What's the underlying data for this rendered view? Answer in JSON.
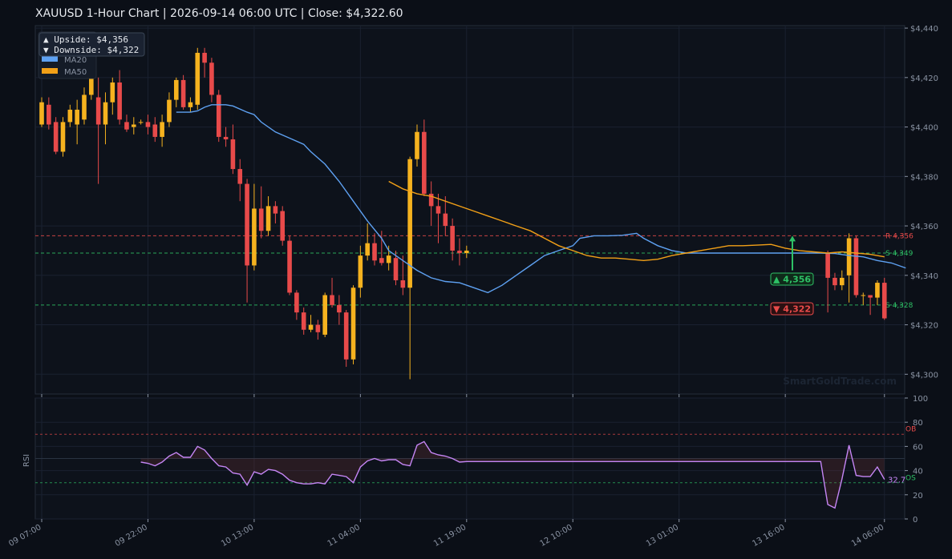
{
  "title": "XAUUSD  1-Hour Chart  |  2026-09-14 06:00 UTC  |  Close: $4,322.60",
  "watermark": "SmartGoldTrade.com",
  "info_box": {
    "upside": "▲ Upside:   $4,356",
    "downside": "▼ Downside: $4,322"
  },
  "badges": {
    "up": "▲ 4,356",
    "down": "▼ 4,322"
  },
  "colors": {
    "bull": "#f5b21f",
    "bear": "#e84a4a",
    "ma20": "#5ea1f2",
    "ma50": "#f2a017",
    "rsi": "#c586f5",
    "resistance": "#e84a4a",
    "support": "#2ec166",
    "background": "#0b0f17"
  },
  "chart_data": [
    {
      "type": "candlestick",
      "name": "price",
      "ylim": [
        4292,
        4441
      ],
      "yticks": [
        "$4,300",
        "$4,320",
        "$4,340",
        "$4,360",
        "$4,380",
        "$4,400",
        "$4,420",
        "$4,440"
      ],
      "ytick_values": [
        4300,
        4320,
        4340,
        4360,
        4380,
        4400,
        4420,
        4440
      ],
      "x_labels": [
        "09 07:00",
        "09 22:00",
        "10 13:00",
        "11 04:00",
        "11 19:00",
        "12 10:00",
        "13 01:00",
        "13 16:00",
        "14 06:00"
      ],
      "x_label_index": [
        0,
        15,
        30,
        45,
        60,
        75,
        90,
        105,
        119
      ],
      "n_slots": 120,
      "candles": [
        [
          0,
          4401,
          4410,
          4412,
          4400
        ],
        [
          1,
          4409,
          4401,
          4412,
          4399
        ],
        [
          2,
          4402,
          4390,
          4404,
          4389
        ],
        [
          3,
          4390,
          4402,
          4404,
          4388
        ],
        [
          4,
          4402,
          4407,
          4409,
          4400
        ],
        [
          5,
          4401,
          4407,
          4411,
          4393
        ],
        [
          6,
          4403,
          4413,
          4416,
          4401
        ],
        [
          7,
          4413,
          4420,
          4424,
          4411
        ],
        [
          8,
          4412,
          4401,
          4420,
          4377
        ],
        [
          9,
          4401,
          4410,
          4414,
          4393
        ],
        [
          10,
          4410,
          4418,
          4420,
          4405
        ],
        [
          11,
          4418,
          4403,
          4423,
          4401
        ],
        [
          12,
          4402,
          4399,
          4405,
          4398
        ],
        [
          13,
          4400,
          4401,
          4404,
          4397
        ],
        [
          14,
          4402,
          4402,
          4403,
          4401
        ],
        [
          15,
          4402,
          4400,
          4405,
          4397
        ],
        [
          16,
          4401,
          4396,
          4404,
          4394
        ],
        [
          17,
          4396,
          4402,
          4405,
          4392
        ],
        [
          18,
          4402,
          4411,
          4414,
          4400
        ],
        [
          19,
          4411,
          4419,
          4420,
          4408
        ],
        [
          20,
          4419,
          4408,
          4421,
          4407
        ],
        [
          21,
          4408,
          4410,
          4412,
          4406
        ],
        [
          22,
          4409,
          4430,
          4432,
          4407
        ],
        [
          23,
          4430,
          4426,
          4432,
          4420
        ],
        [
          24,
          4426,
          4413,
          4428,
          4410
        ],
        [
          25,
          4413,
          4396,
          4415,
          4394
        ],
        [
          26,
          4396,
          4395,
          4400,
          4392
        ],
        [
          27,
          4395,
          4383,
          4401,
          4381
        ],
        [
          28,
          4383,
          4377,
          4387,
          4370
        ],
        [
          29,
          4377,
          4344,
          4379,
          4329
        ],
        [
          30,
          4344,
          4367,
          4377,
          4342
        ],
        [
          31,
          4367,
          4358,
          4376,
          4355
        ],
        [
          32,
          4358,
          4368,
          4372,
          4356
        ],
        [
          33,
          4368,
          4365,
          4370,
          4361
        ],
        [
          34,
          4366,
          4354,
          4368,
          4352
        ],
        [
          35,
          4354,
          4333,
          4356,
          4332
        ],
        [
          36,
          4333,
          4325,
          4334,
          4322
        ],
        [
          37,
          4325,
          4318,
          4327,
          4316
        ],
        [
          38,
          4318,
          4320,
          4324,
          4317
        ],
        [
          39,
          4320,
          4317,
          4322,
          4314
        ],
        [
          40,
          4316,
          4332,
          4333,
          4315
        ],
        [
          41,
          4332,
          4328,
          4339,
          4327
        ],
        [
          42,
          4328,
          4325,
          4332,
          4320
        ],
        [
          43,
          4325,
          4306,
          4326,
          4303
        ],
        [
          44,
          4306,
          4335,
          4336,
          4304
        ],
        [
          45,
          4335,
          4348,
          4352,
          4331
        ],
        [
          46,
          4348,
          4353,
          4361,
          4346
        ],
        [
          47,
          4353,
          4346,
          4357,
          4344
        ],
        [
          48,
          4347,
          4345,
          4358,
          4344
        ],
        [
          49,
          4345,
          4348,
          4352,
          4342
        ],
        [
          50,
          4347,
          4338,
          4350,
          4336
        ],
        [
          51,
          4338,
          4335,
          4348,
          4332
        ],
        [
          52,
          4335,
          4387,
          4388,
          4298
        ],
        [
          53,
          4387,
          4398,
          4401,
          4384
        ],
        [
          54,
          4398,
          4373,
          4403,
          4372
        ],
        [
          55,
          4373,
          4368,
          4378,
          4360
        ],
        [
          56,
          4368,
          4365,
          4373,
          4353
        ],
        [
          57,
          4365,
          4360,
          4372,
          4356
        ],
        [
          58,
          4360,
          4350,
          4363,
          4346
        ],
        [
          59,
          4350,
          4349,
          4355,
          4344
        ],
        [
          60,
          4349,
          4350,
          4352,
          4347
        ],
        [
          111,
          4349,
          4339,
          4350,
          4325
        ],
        [
          112,
          4339,
          4336,
          4341,
          4334
        ],
        [
          113,
          4336,
          4339,
          4342,
          4334
        ],
        [
          114,
          4340,
          4355,
          4357,
          4329
        ],
        [
          115,
          4355,
          4332,
          4356,
          4331
        ],
        [
          116,
          4332,
          4332,
          4333,
          4328
        ],
        [
          117,
          4332,
          4331,
          4332,
          4324
        ],
        [
          118,
          4331,
          4337,
          4338,
          4328
        ],
        [
          119,
          4337,
          4322.6,
          4339,
          4322
        ]
      ],
      "ma20": {
        "name": "MA20",
        "points": [
          [
            19,
            4406
          ],
          [
            21,
            4406
          ],
          [
            22,
            4406.5
          ],
          [
            23,
            4408
          ],
          [
            24,
            4409
          ],
          [
            26,
            4409
          ],
          [
            27,
            4408.5
          ],
          [
            29,
            4406
          ],
          [
            30,
            4405
          ],
          [
            31,
            4402
          ],
          [
            33,
            4398
          ],
          [
            35,
            4395.5
          ],
          [
            37,
            4393
          ],
          [
            38,
            4390
          ],
          [
            40,
            4385
          ],
          [
            42,
            4378
          ],
          [
            44,
            4370
          ],
          [
            46,
            4362
          ],
          [
            48,
            4355
          ],
          [
            49,
            4350
          ],
          [
            51,
            4346
          ],
          [
            53,
            4342
          ],
          [
            55,
            4339
          ],
          [
            57,
            4337.5
          ],
          [
            59,
            4337
          ],
          [
            61,
            4335
          ],
          [
            63,
            4333
          ],
          [
            65,
            4336
          ],
          [
            67,
            4340
          ],
          [
            69,
            4344
          ],
          [
            71,
            4348
          ],
          [
            73,
            4350
          ],
          [
            75,
            4352
          ],
          [
            76,
            4355
          ],
          [
            78,
            4356
          ],
          [
            80,
            4356
          ],
          [
            82,
            4356.2
          ],
          [
            84,
            4357
          ],
          [
            85,
            4355
          ],
          [
            87,
            4352
          ],
          [
            89,
            4350
          ],
          [
            91,
            4349
          ],
          [
            93,
            4349
          ],
          [
            95,
            4349
          ],
          [
            100,
            4349
          ],
          [
            105,
            4349
          ],
          [
            108,
            4349
          ],
          [
            110,
            4349
          ],
          [
            112,
            4348.8
          ],
          [
            114,
            4348
          ],
          [
            116,
            4347.5
          ],
          [
            118,
            4346
          ],
          [
            120,
            4345
          ],
          [
            122,
            4343
          ]
        ]
      },
      "ma50": {
        "name": "MA50",
        "points": [
          [
            49,
            4378
          ],
          [
            51,
            4375
          ],
          [
            53,
            4373
          ],
          [
            55,
            4372
          ],
          [
            57,
            4370
          ],
          [
            59,
            4368
          ],
          [
            61,
            4366
          ],
          [
            63,
            4364
          ],
          [
            65,
            4362
          ],
          [
            67,
            4360
          ],
          [
            69,
            4358
          ],
          [
            71,
            4355
          ],
          [
            73,
            4352
          ],
          [
            75,
            4350
          ],
          [
            77,
            4348
          ],
          [
            79,
            4347
          ],
          [
            81,
            4347
          ],
          [
            83,
            4346.5
          ],
          [
            85,
            4346
          ],
          [
            87,
            4346.5
          ],
          [
            89,
            4348
          ],
          [
            91,
            4349
          ],
          [
            93,
            4350
          ],
          [
            95,
            4351
          ],
          [
            97,
            4352
          ],
          [
            99,
            4352
          ],
          [
            101,
            4352.2
          ],
          [
            103,
            4352.5
          ],
          [
            105,
            4351
          ],
          [
            107,
            4350
          ],
          [
            109,
            4349.5
          ],
          [
            111,
            4349
          ],
          [
            113,
            4349.5
          ],
          [
            115,
            4349
          ],
          [
            117,
            4348.5
          ],
          [
            119,
            4347.5
          ]
        ]
      },
      "levels": [
        {
          "label": "R 4,356",
          "value": 4356,
          "kind": "resistance"
        },
        {
          "label": "S 4,349",
          "value": 4349,
          "kind": "support"
        },
        {
          "label": "S 4,328",
          "value": 4328,
          "kind": "support"
        }
      ]
    },
    {
      "type": "line",
      "name": "rsi",
      "ylabel": "RSI",
      "ylim": [
        0,
        100
      ],
      "yticks": [
        "0",
        "20",
        "40",
        "60",
        "80",
        "100"
      ],
      "ytick_values": [
        0,
        20,
        40,
        60,
        80,
        100
      ],
      "overbought": {
        "label": "OB",
        "value": 70
      },
      "oversold": {
        "label": "OS",
        "value": 30
      },
      "last_label": "32.7",
      "points": [
        [
          14,
          47
        ],
        [
          15,
          46
        ],
        [
          16,
          44
        ],
        [
          17,
          47
        ],
        [
          18,
          52
        ],
        [
          19,
          55
        ],
        [
          20,
          51
        ],
        [
          21,
          51
        ],
        [
          22,
          60
        ],
        [
          23,
          57
        ],
        [
          24,
          50
        ],
        [
          25,
          44
        ],
        [
          26,
          43
        ],
        [
          27,
          38
        ],
        [
          28,
          37
        ],
        [
          29,
          28
        ],
        [
          30,
          39
        ],
        [
          31,
          37
        ],
        [
          32,
          41
        ],
        [
          33,
          40
        ],
        [
          34,
          37
        ],
        [
          35,
          32
        ],
        [
          36,
          30
        ],
        [
          37,
          29
        ],
        [
          38,
          29
        ],
        [
          39,
          30
        ],
        [
          40,
          29
        ],
        [
          41,
          37
        ],
        [
          42,
          36
        ],
        [
          43,
          35
        ],
        [
          44,
          30
        ],
        [
          45,
          43
        ],
        [
          46,
          48
        ],
        [
          47,
          50
        ],
        [
          48,
          48
        ],
        [
          49,
          49
        ],
        [
          50,
          49
        ],
        [
          51,
          45
        ],
        [
          52,
          44
        ],
        [
          53,
          61
        ],
        [
          54,
          64
        ],
        [
          55,
          55
        ],
        [
          56,
          53
        ],
        [
          57,
          52
        ],
        [
          58,
          50
        ],
        [
          59,
          47
        ],
        [
          60,
          47.5
        ],
        [
          61,
          47.5
        ],
        [
          80,
          47.5
        ],
        [
          100,
          47.5
        ],
        [
          110,
          47.5
        ],
        [
          111,
          12
        ],
        [
          112,
          9
        ],
        [
          113,
          33
        ],
        [
          114,
          61
        ],
        [
          115,
          36
        ],
        [
          116,
          35
        ],
        [
          117,
          35
        ],
        [
          118,
          43
        ],
        [
          119,
          32.7
        ]
      ]
    }
  ]
}
